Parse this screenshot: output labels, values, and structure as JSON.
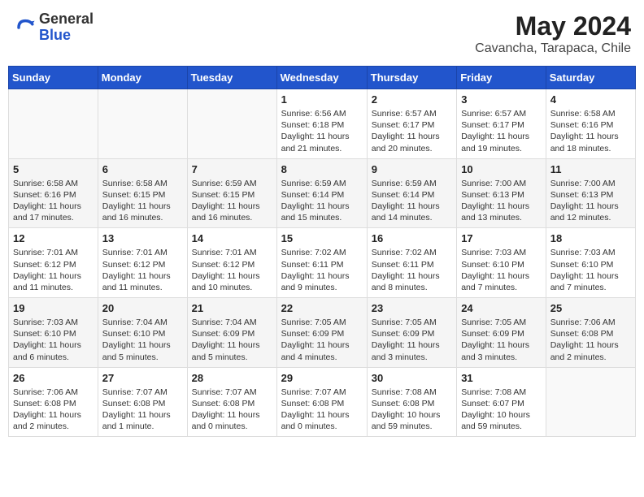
{
  "header": {
    "logo_general": "General",
    "logo_blue": "Blue",
    "title": "May 2024",
    "subtitle": "Cavancha, Tarapaca, Chile"
  },
  "weekdays": [
    "Sunday",
    "Monday",
    "Tuesday",
    "Wednesday",
    "Thursday",
    "Friday",
    "Saturday"
  ],
  "weeks": [
    [
      {
        "day": "",
        "info": ""
      },
      {
        "day": "",
        "info": ""
      },
      {
        "day": "",
        "info": ""
      },
      {
        "day": "1",
        "info": "Sunrise: 6:56 AM\nSunset: 6:18 PM\nDaylight: 11 hours and 21 minutes."
      },
      {
        "day": "2",
        "info": "Sunrise: 6:57 AM\nSunset: 6:17 PM\nDaylight: 11 hours and 20 minutes."
      },
      {
        "day": "3",
        "info": "Sunrise: 6:57 AM\nSunset: 6:17 PM\nDaylight: 11 hours and 19 minutes."
      },
      {
        "day": "4",
        "info": "Sunrise: 6:58 AM\nSunset: 6:16 PM\nDaylight: 11 hours and 18 minutes."
      }
    ],
    [
      {
        "day": "5",
        "info": "Sunrise: 6:58 AM\nSunset: 6:16 PM\nDaylight: 11 hours and 17 minutes."
      },
      {
        "day": "6",
        "info": "Sunrise: 6:58 AM\nSunset: 6:15 PM\nDaylight: 11 hours and 16 minutes."
      },
      {
        "day": "7",
        "info": "Sunrise: 6:59 AM\nSunset: 6:15 PM\nDaylight: 11 hours and 16 minutes."
      },
      {
        "day": "8",
        "info": "Sunrise: 6:59 AM\nSunset: 6:14 PM\nDaylight: 11 hours and 15 minutes."
      },
      {
        "day": "9",
        "info": "Sunrise: 6:59 AM\nSunset: 6:14 PM\nDaylight: 11 hours and 14 minutes."
      },
      {
        "day": "10",
        "info": "Sunrise: 7:00 AM\nSunset: 6:13 PM\nDaylight: 11 hours and 13 minutes."
      },
      {
        "day": "11",
        "info": "Sunrise: 7:00 AM\nSunset: 6:13 PM\nDaylight: 11 hours and 12 minutes."
      }
    ],
    [
      {
        "day": "12",
        "info": "Sunrise: 7:01 AM\nSunset: 6:12 PM\nDaylight: 11 hours and 11 minutes."
      },
      {
        "day": "13",
        "info": "Sunrise: 7:01 AM\nSunset: 6:12 PM\nDaylight: 11 hours and 11 minutes."
      },
      {
        "day": "14",
        "info": "Sunrise: 7:01 AM\nSunset: 6:12 PM\nDaylight: 11 hours and 10 minutes."
      },
      {
        "day": "15",
        "info": "Sunrise: 7:02 AM\nSunset: 6:11 PM\nDaylight: 11 hours and 9 minutes."
      },
      {
        "day": "16",
        "info": "Sunrise: 7:02 AM\nSunset: 6:11 PM\nDaylight: 11 hours and 8 minutes."
      },
      {
        "day": "17",
        "info": "Sunrise: 7:03 AM\nSunset: 6:10 PM\nDaylight: 11 hours and 7 minutes."
      },
      {
        "day": "18",
        "info": "Sunrise: 7:03 AM\nSunset: 6:10 PM\nDaylight: 11 hours and 7 minutes."
      }
    ],
    [
      {
        "day": "19",
        "info": "Sunrise: 7:03 AM\nSunset: 6:10 PM\nDaylight: 11 hours and 6 minutes."
      },
      {
        "day": "20",
        "info": "Sunrise: 7:04 AM\nSunset: 6:10 PM\nDaylight: 11 hours and 5 minutes."
      },
      {
        "day": "21",
        "info": "Sunrise: 7:04 AM\nSunset: 6:09 PM\nDaylight: 11 hours and 5 minutes."
      },
      {
        "day": "22",
        "info": "Sunrise: 7:05 AM\nSunset: 6:09 PM\nDaylight: 11 hours and 4 minutes."
      },
      {
        "day": "23",
        "info": "Sunrise: 7:05 AM\nSunset: 6:09 PM\nDaylight: 11 hours and 3 minutes."
      },
      {
        "day": "24",
        "info": "Sunrise: 7:05 AM\nSunset: 6:09 PM\nDaylight: 11 hours and 3 minutes."
      },
      {
        "day": "25",
        "info": "Sunrise: 7:06 AM\nSunset: 6:08 PM\nDaylight: 11 hours and 2 minutes."
      }
    ],
    [
      {
        "day": "26",
        "info": "Sunrise: 7:06 AM\nSunset: 6:08 PM\nDaylight: 11 hours and 2 minutes."
      },
      {
        "day": "27",
        "info": "Sunrise: 7:07 AM\nSunset: 6:08 PM\nDaylight: 11 hours and 1 minute."
      },
      {
        "day": "28",
        "info": "Sunrise: 7:07 AM\nSunset: 6:08 PM\nDaylight: 11 hours and 0 minutes."
      },
      {
        "day": "29",
        "info": "Sunrise: 7:07 AM\nSunset: 6:08 PM\nDaylight: 11 hours and 0 minutes."
      },
      {
        "day": "30",
        "info": "Sunrise: 7:08 AM\nSunset: 6:08 PM\nDaylight: 10 hours and 59 minutes."
      },
      {
        "day": "31",
        "info": "Sunrise: 7:08 AM\nSunset: 6:07 PM\nDaylight: 10 hours and 59 minutes."
      },
      {
        "day": "",
        "info": ""
      }
    ]
  ]
}
